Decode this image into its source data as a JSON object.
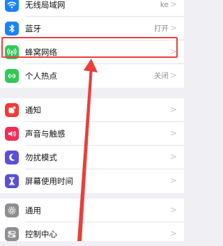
{
  "group1": {
    "items": [
      {
        "label": "无线局域网",
        "value": "ke",
        "icon": "wifi-icon",
        "color": "#1a82fb"
      },
      {
        "label": "蓝牙",
        "value": "打开",
        "icon": "bluetooth-icon",
        "color": "#1a82fb"
      },
      {
        "label": "蜂窝网络",
        "value": "",
        "icon": "antenna-icon",
        "color": "#34c759"
      },
      {
        "label": "个人热点",
        "value": "关闭",
        "icon": "hotspot-icon",
        "color": "#34c759"
      }
    ]
  },
  "group2": {
    "items": [
      {
        "label": "通知",
        "icon": "notification-icon",
        "color": "#f23b36"
      },
      {
        "label": "声音与触感",
        "icon": "speaker-icon",
        "color": "#f02d56"
      },
      {
        "label": "勿扰模式",
        "icon": "moon-icon",
        "color": "#5a4fd6"
      },
      {
        "label": "屏幕使用时间",
        "icon": "hourglass-icon",
        "color": "#5a4fd6"
      }
    ]
  },
  "group3": {
    "items": [
      {
        "label": "通用",
        "icon": "gear-icon",
        "color": "#8e8e93"
      },
      {
        "label": "控制中心",
        "icon": "toggles-icon",
        "color": "#8e8e93"
      }
    ]
  },
  "annotation": {
    "color": "#e8403a"
  }
}
